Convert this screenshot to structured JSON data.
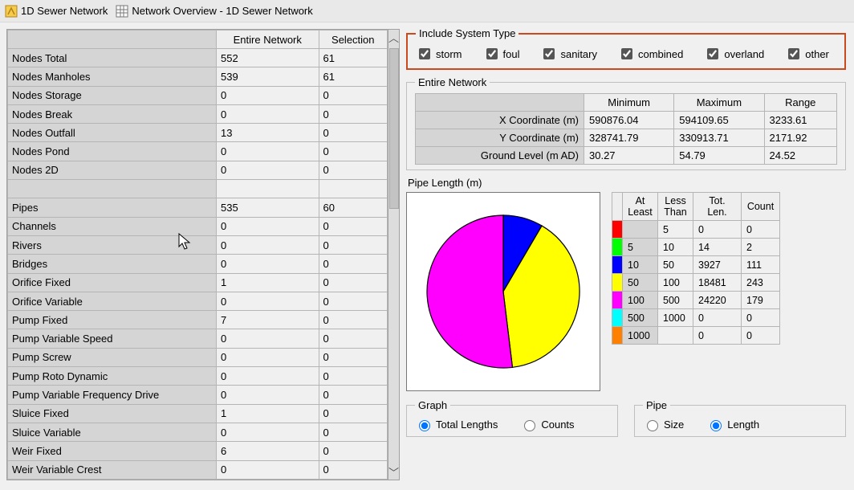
{
  "titlebar": {
    "app_title": "1D Sewer Network",
    "page_title": "Network Overview - 1D Sewer Network"
  },
  "left_table": {
    "header_blank": "",
    "header_entire": "Entire Network",
    "header_selection": "Selection",
    "rows": [
      {
        "label": "Nodes Total",
        "entire": "552",
        "sel": "61"
      },
      {
        "label": "Nodes Manholes",
        "entire": "539",
        "sel": "61"
      },
      {
        "label": "Nodes Storage",
        "entire": "0",
        "sel": "0"
      },
      {
        "label": "Nodes Break",
        "entire": "0",
        "sel": "0"
      },
      {
        "label": "Nodes Outfall",
        "entire": "13",
        "sel": "0"
      },
      {
        "label": "Nodes Pond",
        "entire": "0",
        "sel": "0"
      },
      {
        "label": "Nodes 2D",
        "entire": "0",
        "sel": "0"
      },
      {
        "blank": true
      },
      {
        "label": "Pipes",
        "entire": "535",
        "sel": "60"
      },
      {
        "label": "Channels",
        "entire": "0",
        "sel": "0"
      },
      {
        "label": "Rivers",
        "entire": "0",
        "sel": "0"
      },
      {
        "label": "Bridges",
        "entire": "0",
        "sel": "0"
      },
      {
        "label": "Orifice Fixed",
        "entire": "1",
        "sel": "0"
      },
      {
        "label": "Orifice Variable",
        "entire": "0",
        "sel": "0"
      },
      {
        "label": "Pump Fixed",
        "entire": "7",
        "sel": "0"
      },
      {
        "label": "Pump Variable Speed",
        "entire": "0",
        "sel": "0"
      },
      {
        "label": "Pump Screw",
        "entire": "0",
        "sel": "0"
      },
      {
        "label": "Pump Roto Dynamic",
        "entire": "0",
        "sel": "0"
      },
      {
        "label": "Pump Variable Frequency Drive",
        "entire": "0",
        "sel": "0"
      },
      {
        "label": "Sluice Fixed",
        "entire": "1",
        "sel": "0"
      },
      {
        "label": "Sluice Variable",
        "entire": "0",
        "sel": "0"
      },
      {
        "label": "Weir Fixed",
        "entire": "6",
        "sel": "0"
      },
      {
        "label": "Weir Variable Crest",
        "entire": "0",
        "sel": "0"
      }
    ]
  },
  "system_type": {
    "legend": "Include System Type",
    "options": [
      {
        "name": "storm",
        "label": "storm",
        "checked": true
      },
      {
        "name": "foul",
        "label": "foul",
        "checked": true
      },
      {
        "name": "sanitary",
        "label": "sanitary",
        "checked": true
      },
      {
        "name": "combined",
        "label": "combined",
        "checked": true
      },
      {
        "name": "overland",
        "label": "overland",
        "checked": true
      },
      {
        "name": "other",
        "label": "other",
        "checked": true
      }
    ]
  },
  "entire_network": {
    "legend": "Entire Network",
    "cols": {
      "min": "Minimum",
      "max": "Maximum",
      "range": "Range"
    },
    "rows": [
      {
        "label": "X Coordinate (m)",
        "min": "590876.04",
        "max": "594109.65",
        "range": "3233.61"
      },
      {
        "label": "Y Coordinate (m)",
        "min": "328741.79",
        "max": "330913.71",
        "range": "2171.92"
      },
      {
        "label": "Ground Level (m AD)",
        "min": "30.27",
        "max": "54.79",
        "range": "24.52"
      }
    ]
  },
  "pipe_length": {
    "title": "Pipe Length (m)",
    "bins": [
      {
        "color": "#ff0000",
        "atleast": "",
        "lessthan": "5",
        "totlen": "0",
        "count": "0"
      },
      {
        "color": "#00ff00",
        "atleast": "5",
        "lessthan": "10",
        "totlen": "14",
        "count": "2"
      },
      {
        "color": "#0000ff",
        "atleast": "10",
        "lessthan": "50",
        "totlen": "3927",
        "count": "111"
      },
      {
        "color": "#ffff00",
        "atleast": "50",
        "lessthan": "100",
        "totlen": "18481",
        "count": "243"
      },
      {
        "color": "#ff00ff",
        "atleast": "100",
        "lessthan": "500",
        "totlen": "24220",
        "count": "179"
      },
      {
        "color": "#00ffff",
        "atleast": "500",
        "lessthan": "1000",
        "totlen": "0",
        "count": "0"
      },
      {
        "color": "#ff8000",
        "atleast": "1000",
        "lessthan": "",
        "totlen": "0",
        "count": "0"
      }
    ],
    "bin_headers": {
      "atleast": "At Least",
      "lessthan": "Less Than",
      "totlen": "Tot. Len.",
      "count": "Count"
    }
  },
  "graph_group": {
    "legend": "Graph",
    "total_lengths": "Total Lengths",
    "counts": "Counts",
    "selected": "total_lengths"
  },
  "pipe_group": {
    "legend": "Pipe",
    "size": "Size",
    "length": "Length",
    "selected": "length"
  },
  "chart_data": {
    "type": "pie",
    "title": "Pipe Length (m)",
    "series": [
      {
        "name": "<5",
        "value": 0,
        "color": "#ff0000"
      },
      {
        "name": "5-10",
        "value": 14,
        "color": "#00ff00"
      },
      {
        "name": "10-50",
        "value": 3927,
        "color": "#0000ff"
      },
      {
        "name": "50-100",
        "value": 18481,
        "color": "#ffff00"
      },
      {
        "name": "100-500",
        "value": 24220,
        "color": "#ff00ff"
      },
      {
        "name": "500-1000",
        "value": 0,
        "color": "#00ffff"
      },
      {
        "name": ">=1000",
        "value": 0,
        "color": "#ff8000"
      }
    ]
  }
}
